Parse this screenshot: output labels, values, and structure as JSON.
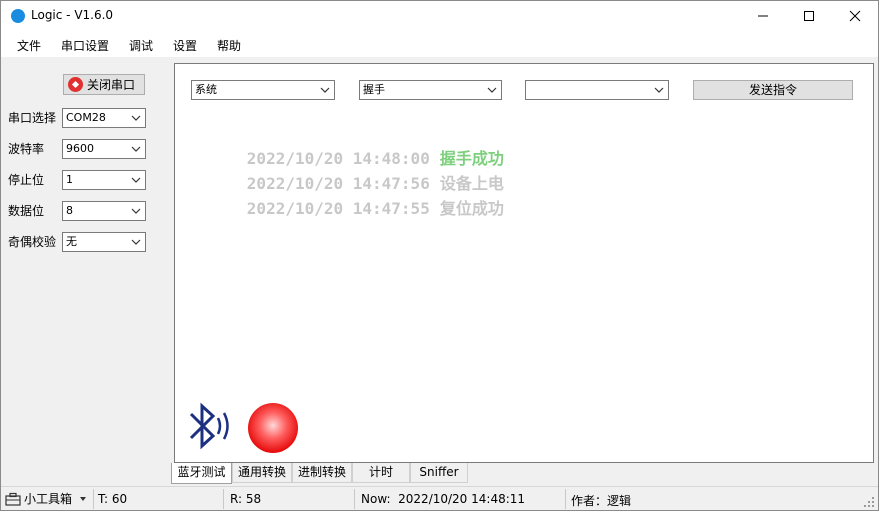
{
  "window": {
    "title": "Logic - V1.6.0"
  },
  "menu": {
    "items": [
      "文件",
      "串口设置",
      "调试",
      "设置",
      "帮助"
    ]
  },
  "serial": {
    "close_label": "关闭串口",
    "fields": [
      {
        "label": "串口选择",
        "value": "COM28"
      },
      {
        "label": "波特率",
        "value": "9600"
      },
      {
        "label": "停止位",
        "value": "1"
      },
      {
        "label": "数据位",
        "value": "8"
      },
      {
        "label": "奇偶校验",
        "value": "无"
      }
    ]
  },
  "command": {
    "category": "系统",
    "action": "握手",
    "param": "",
    "send_label": "发送指令"
  },
  "log": [
    {
      "time": "2022/10/20 14:48:00",
      "msg": "握手成功",
      "color": "#7ed07e"
    },
    {
      "time": "2022/10/20 14:47:56",
      "msg": "设备上电",
      "color": "#c8c8c8"
    },
    {
      "time": "2022/10/20 14:47:55",
      "msg": "复位成功",
      "color": "#c8c8c8"
    }
  ],
  "tabs": [
    "蓝牙测试",
    "通用转换",
    "进制转换",
    "计时",
    "Sniffer"
  ],
  "status": {
    "toolbox_label": "小工具箱",
    "t": "T: 60",
    "r": "R: 58",
    "now": "Now:  2022/10/20 14:48:11",
    "author": "作者：逻辑"
  },
  "colors": {
    "bluetooth": "#1c2f80",
    "led": "#e81010",
    "success": "#7ed07e"
  }
}
